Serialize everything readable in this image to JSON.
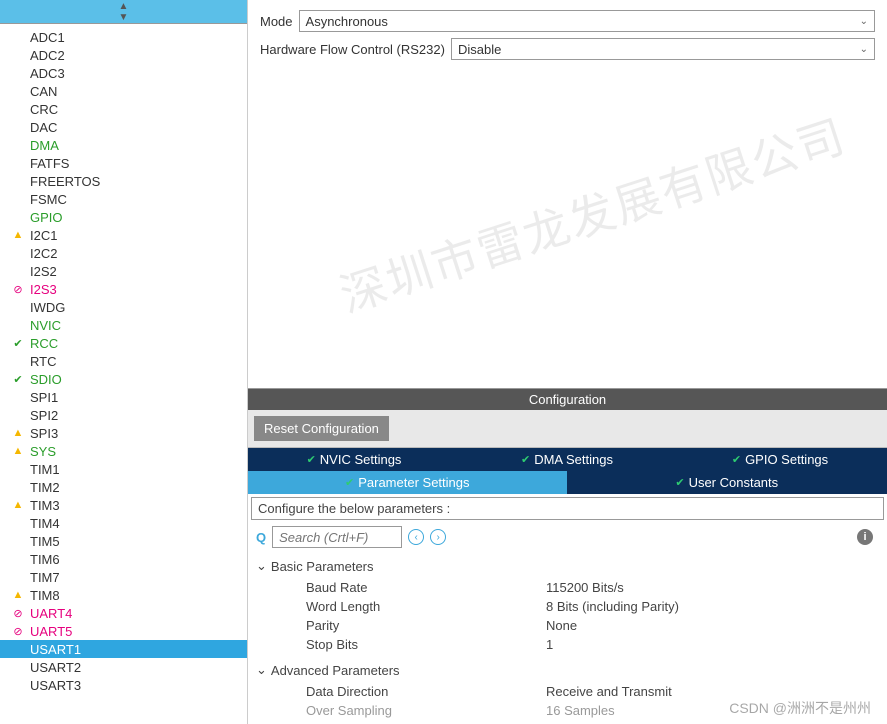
{
  "sidebar": {
    "items": [
      {
        "label": "ADC1",
        "status": "",
        "color": ""
      },
      {
        "label": "ADC2",
        "status": "",
        "color": ""
      },
      {
        "label": "ADC3",
        "status": "",
        "color": ""
      },
      {
        "label": "CAN",
        "status": "",
        "color": ""
      },
      {
        "label": "CRC",
        "status": "",
        "color": ""
      },
      {
        "label": "DAC",
        "status": "",
        "color": ""
      },
      {
        "label": "DMA",
        "status": "",
        "color": "green"
      },
      {
        "label": "FATFS",
        "status": "",
        "color": ""
      },
      {
        "label": "FREERTOS",
        "status": "",
        "color": ""
      },
      {
        "label": "FSMC",
        "status": "",
        "color": ""
      },
      {
        "label": "GPIO",
        "status": "",
        "color": "green"
      },
      {
        "label": "I2C1",
        "status": "warn",
        "color": ""
      },
      {
        "label": "I2C2",
        "status": "",
        "color": ""
      },
      {
        "label": "I2S2",
        "status": "",
        "color": ""
      },
      {
        "label": "I2S3",
        "status": "err",
        "color": "magenta"
      },
      {
        "label": "IWDG",
        "status": "",
        "color": ""
      },
      {
        "label": "NVIC",
        "status": "",
        "color": "green"
      },
      {
        "label": "RCC",
        "status": "ok",
        "color": "green"
      },
      {
        "label": "RTC",
        "status": "",
        "color": ""
      },
      {
        "label": "SDIO",
        "status": "ok",
        "color": "green"
      },
      {
        "label": "SPI1",
        "status": "",
        "color": ""
      },
      {
        "label": "SPI2",
        "status": "",
        "color": ""
      },
      {
        "label": "SPI3",
        "status": "warn",
        "color": ""
      },
      {
        "label": "SYS",
        "status": "warn",
        "color": "green"
      },
      {
        "label": "TIM1",
        "status": "",
        "color": ""
      },
      {
        "label": "TIM2",
        "status": "",
        "color": ""
      },
      {
        "label": "TIM3",
        "status": "warn",
        "color": ""
      },
      {
        "label": "TIM4",
        "status": "",
        "color": ""
      },
      {
        "label": "TIM5",
        "status": "",
        "color": ""
      },
      {
        "label": "TIM6",
        "status": "",
        "color": ""
      },
      {
        "label": "TIM7",
        "status": "",
        "color": ""
      },
      {
        "label": "TIM8",
        "status": "warn",
        "color": ""
      },
      {
        "label": "UART4",
        "status": "err",
        "color": "magenta"
      },
      {
        "label": "UART5",
        "status": "err",
        "color": "magenta"
      },
      {
        "label": "USART1",
        "status": "",
        "color": "",
        "selected": true
      },
      {
        "label": "USART2",
        "status": "",
        "color": ""
      },
      {
        "label": "USART3",
        "status": "",
        "color": ""
      }
    ]
  },
  "mode": {
    "mode_label": "Mode",
    "mode_value": "Asynchronous",
    "hw_label": "Hardware Flow Control (RS232)",
    "hw_value": "Disable"
  },
  "config": {
    "title": "Configuration",
    "reset_label": "Reset Configuration",
    "tabs_row1": [
      {
        "label": "NVIC Settings"
      },
      {
        "label": "DMA Settings"
      },
      {
        "label": "GPIO Settings"
      }
    ],
    "tabs_row2": [
      {
        "label": "Parameter Settings",
        "active": true
      },
      {
        "label": "User Constants"
      }
    ],
    "hint": "Configure the below parameters :",
    "search_placeholder": "Search (Crtl+F)",
    "groups": [
      {
        "name": "Basic Parameters",
        "rows": [
          {
            "name": "Baud Rate",
            "value": "115200 Bits/s"
          },
          {
            "name": "Word Length",
            "value": "8 Bits (including Parity)"
          },
          {
            "name": "Parity",
            "value": "None"
          },
          {
            "name": "Stop Bits",
            "value": "1"
          }
        ]
      },
      {
        "name": "Advanced Parameters",
        "rows": [
          {
            "name": "Data Direction",
            "value": "Receive and Transmit"
          },
          {
            "name": "Over Sampling",
            "value": "16 Samples",
            "disabled": true
          }
        ]
      }
    ]
  },
  "watermark": {
    "main": "深圳市雷龙发展有限公司",
    "footer": "CSDN @洲洲不是州州"
  }
}
